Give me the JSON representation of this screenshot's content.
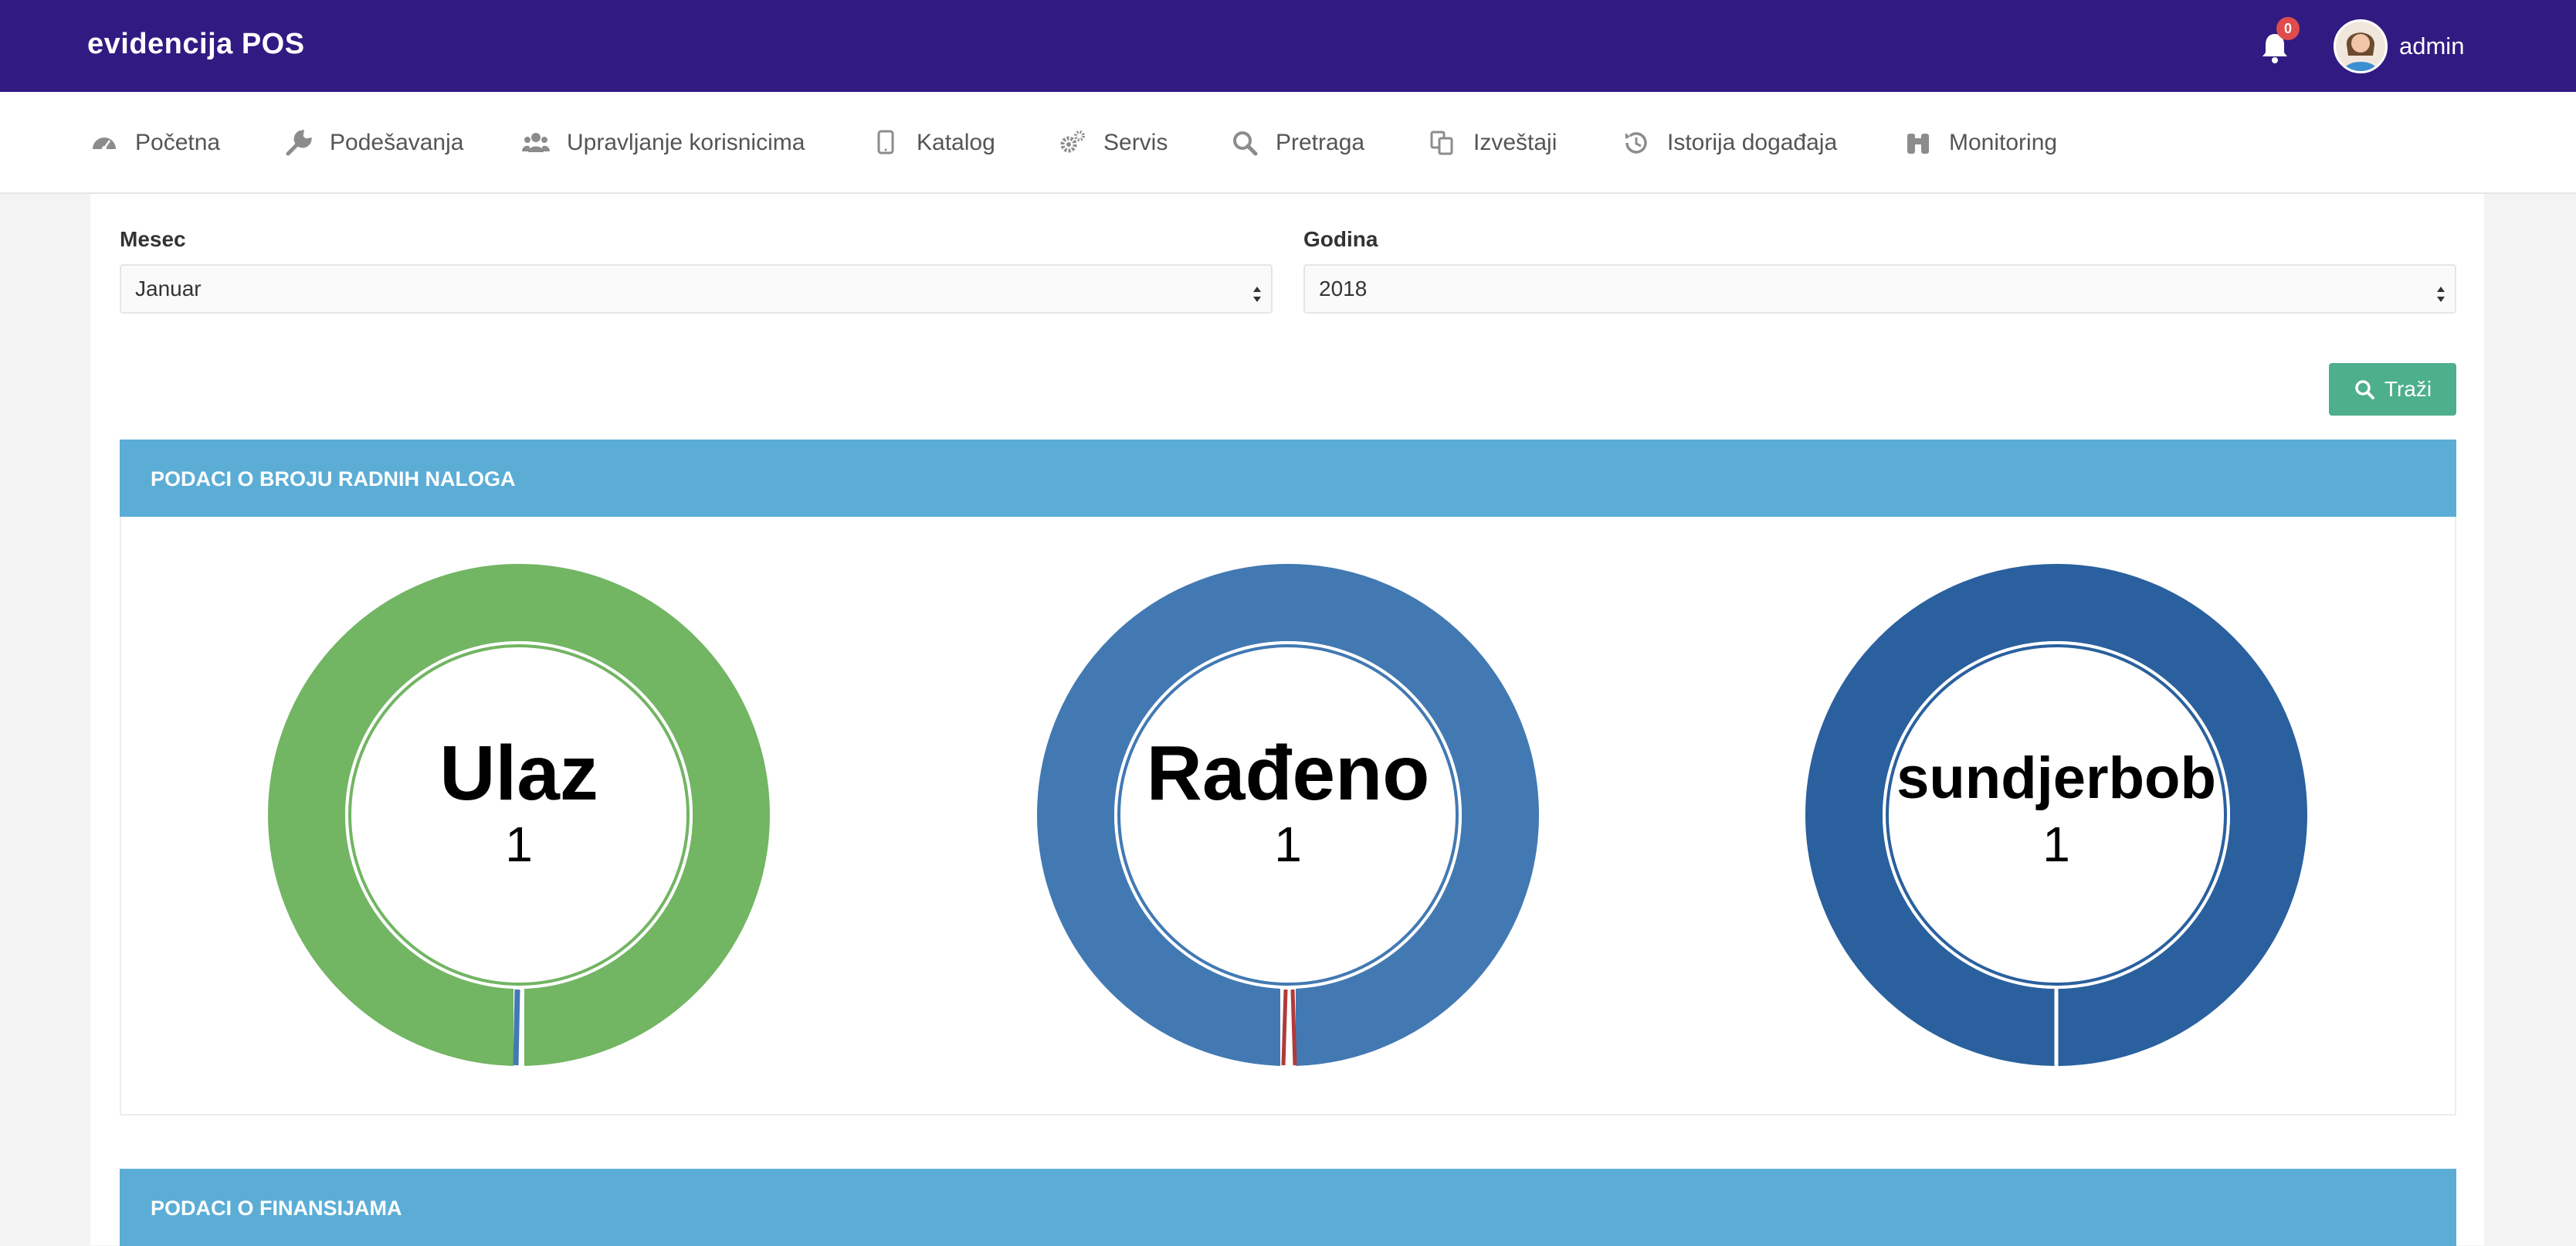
{
  "header": {
    "brand": "evidencija POS",
    "notifications_count": "0",
    "username": "admin"
  },
  "nav": {
    "items": [
      {
        "label": "Početna",
        "icon": "dashboard-icon"
      },
      {
        "label": "Podešavanja",
        "icon": "wrench-icon"
      },
      {
        "label": "Upravljanje korisnicima",
        "icon": "users-icon"
      },
      {
        "label": "Katalog",
        "icon": "tablet-icon"
      },
      {
        "label": "Servis",
        "icon": "gears-icon"
      },
      {
        "label": "Pretraga",
        "icon": "search-icon"
      },
      {
        "label": "Izveštaji",
        "icon": "copy-icon"
      },
      {
        "label": "Istorija događaja",
        "icon": "history-icon"
      },
      {
        "label": "Monitoring",
        "icon": "binoculars-icon"
      }
    ]
  },
  "filters": {
    "month_label": "Mesec",
    "month_value": "Januar",
    "year_label": "Godina",
    "year_value": "2018",
    "search_button": "Traži"
  },
  "sections": {
    "work_orders_title": "PODACI O BROJU RADNIH NALOGA",
    "finance_title": "PODACI O FINANSIJAMA"
  },
  "charts": [
    {
      "title": "Ulaz",
      "value": "1",
      "color": "#72b563"
    },
    {
      "title": "Rađeno",
      "value": "1",
      "color": "#4279b3"
    },
    {
      "title": "sundjerbob",
      "value": "1",
      "color": "#2a609e"
    }
  ],
  "colors": {
    "topbar": "#311b82",
    "section_header": "#5badd6",
    "button": "#4daf8c",
    "badge": "#e04b4b"
  }
}
